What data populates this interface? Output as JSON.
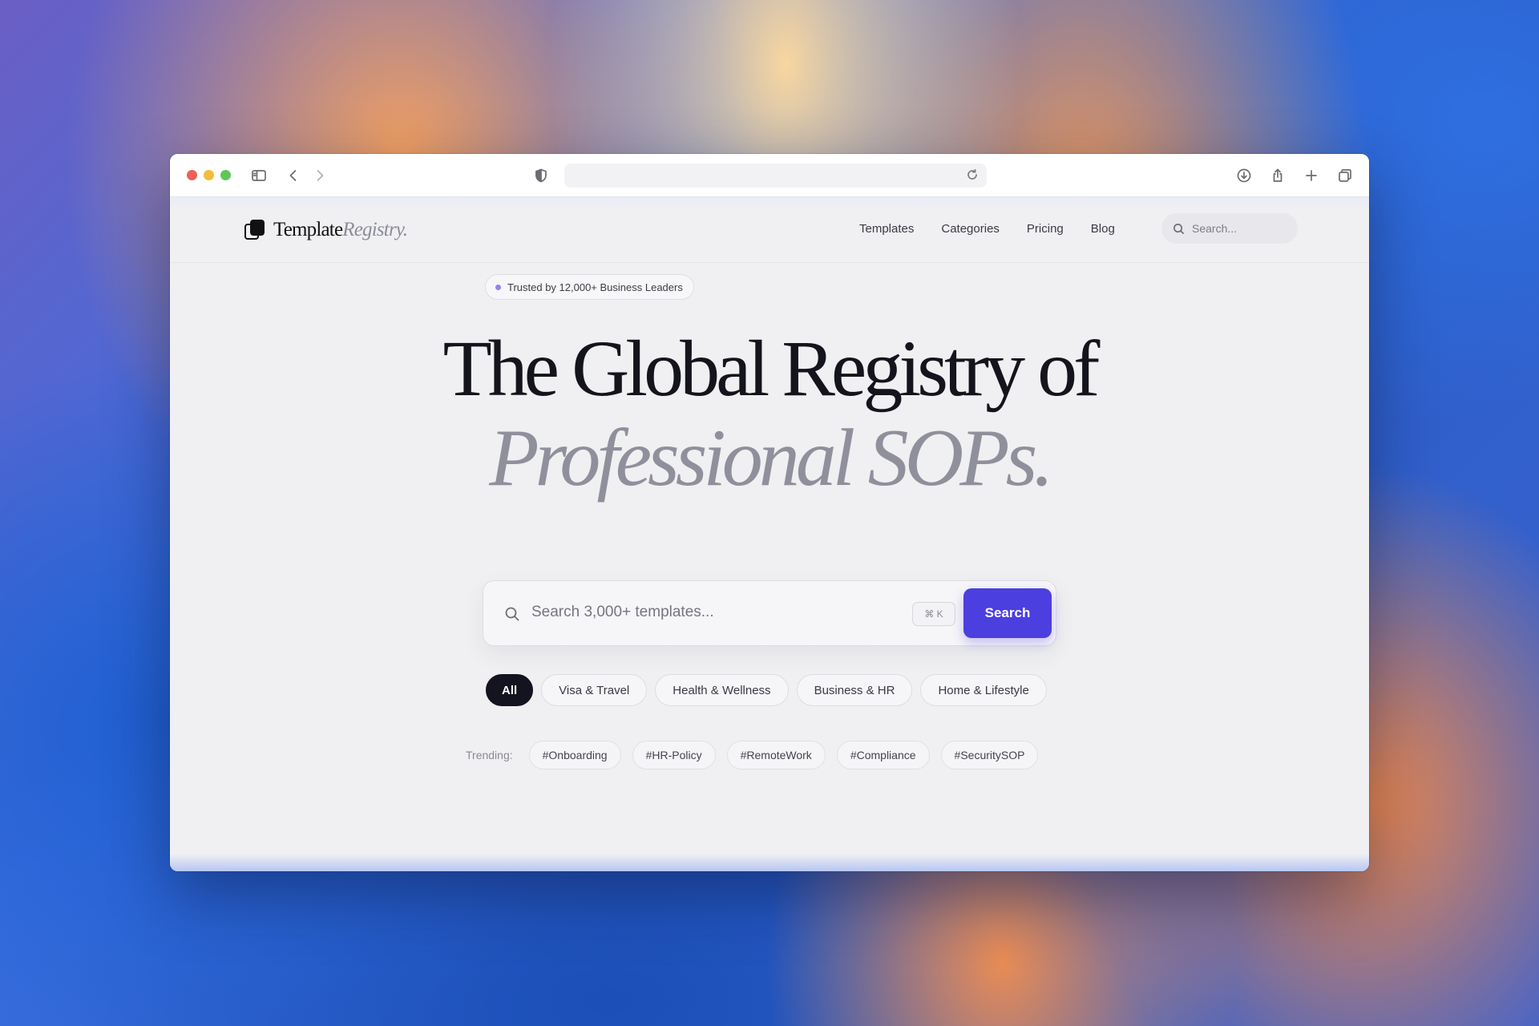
{
  "browser": {
    "icons": [
      "sidebar-icon",
      "back-icon",
      "forward-icon",
      "shield-icon",
      "reload-icon",
      "download-icon",
      "share-icon",
      "new-tab-icon",
      "tabs-overview-icon"
    ]
  },
  "nav": {
    "logo_main": "Template",
    "logo_accent": "Registry.",
    "links": [
      "Templates",
      "Categories",
      "Pricing",
      "Blog"
    ],
    "search_placeholder": "Search..."
  },
  "hero": {
    "badge": "Trusted by 12,000+ Business Leaders",
    "headline_line1": "The Global Registry of",
    "headline_line2": "Professional SOPs.",
    "search_placeholder": "Search 3,000+ templates...",
    "shortcut": "⌘ K",
    "search_button": "Search"
  },
  "categories": [
    "All",
    "Visa & Travel",
    "Health & Wellness",
    "Business & HR",
    "Home & Lifestyle"
  ],
  "trending": {
    "label": "Trending:",
    "tags": [
      "#Onboarding",
      "#HR-Policy",
      "#RemoteWork",
      "#Compliance",
      "#SecuritySOP"
    ]
  },
  "colors": {
    "accent": "#4b3fe0",
    "active_chip": "#141420",
    "badge_dot": "#8d86f2"
  }
}
